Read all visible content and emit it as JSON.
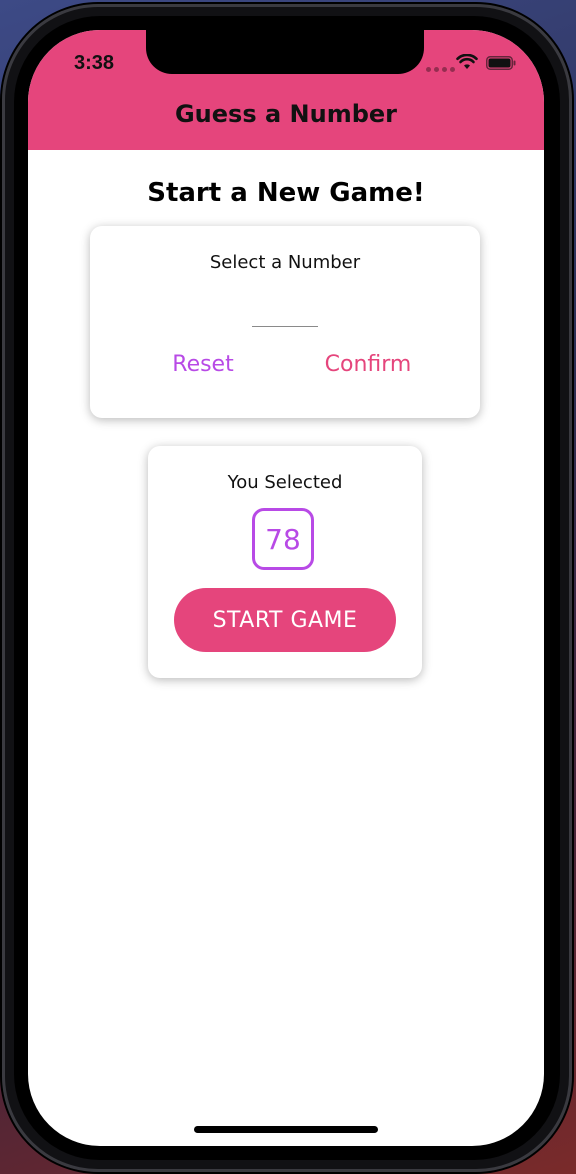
{
  "status_bar": {
    "time": "3:38"
  },
  "header": {
    "title": "Guess a Number"
  },
  "main": {
    "heading": "Start a New Game!",
    "input_card": {
      "label": "Select a Number",
      "input_value": "",
      "reset_label": "Reset",
      "confirm_label": "Confirm"
    },
    "selected_card": {
      "label": "You Selected",
      "number": "78",
      "start_label": "START GAME"
    }
  },
  "colors": {
    "primary": "#e5457c",
    "accent": "#b84ae6",
    "reset": "#b84ae6",
    "confirm": "#e5457c"
  },
  "icons": [
    "wifi-icon",
    "battery-icon",
    "cellular-signal-icon"
  ]
}
